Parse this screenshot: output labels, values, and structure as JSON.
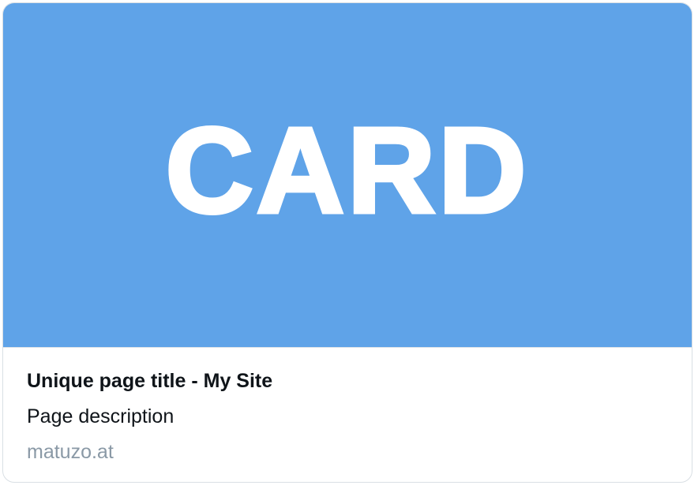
{
  "card": {
    "image_text": "CARD",
    "title": "Unique page title - My Site",
    "description": "Page description",
    "domain": "matuzo.at"
  },
  "colors": {
    "image_background": "#5fa3e8",
    "image_text": "#ffffff",
    "title_text": "#0f1419",
    "domain_text": "#8a99a6",
    "border": "#d9dfe4"
  }
}
